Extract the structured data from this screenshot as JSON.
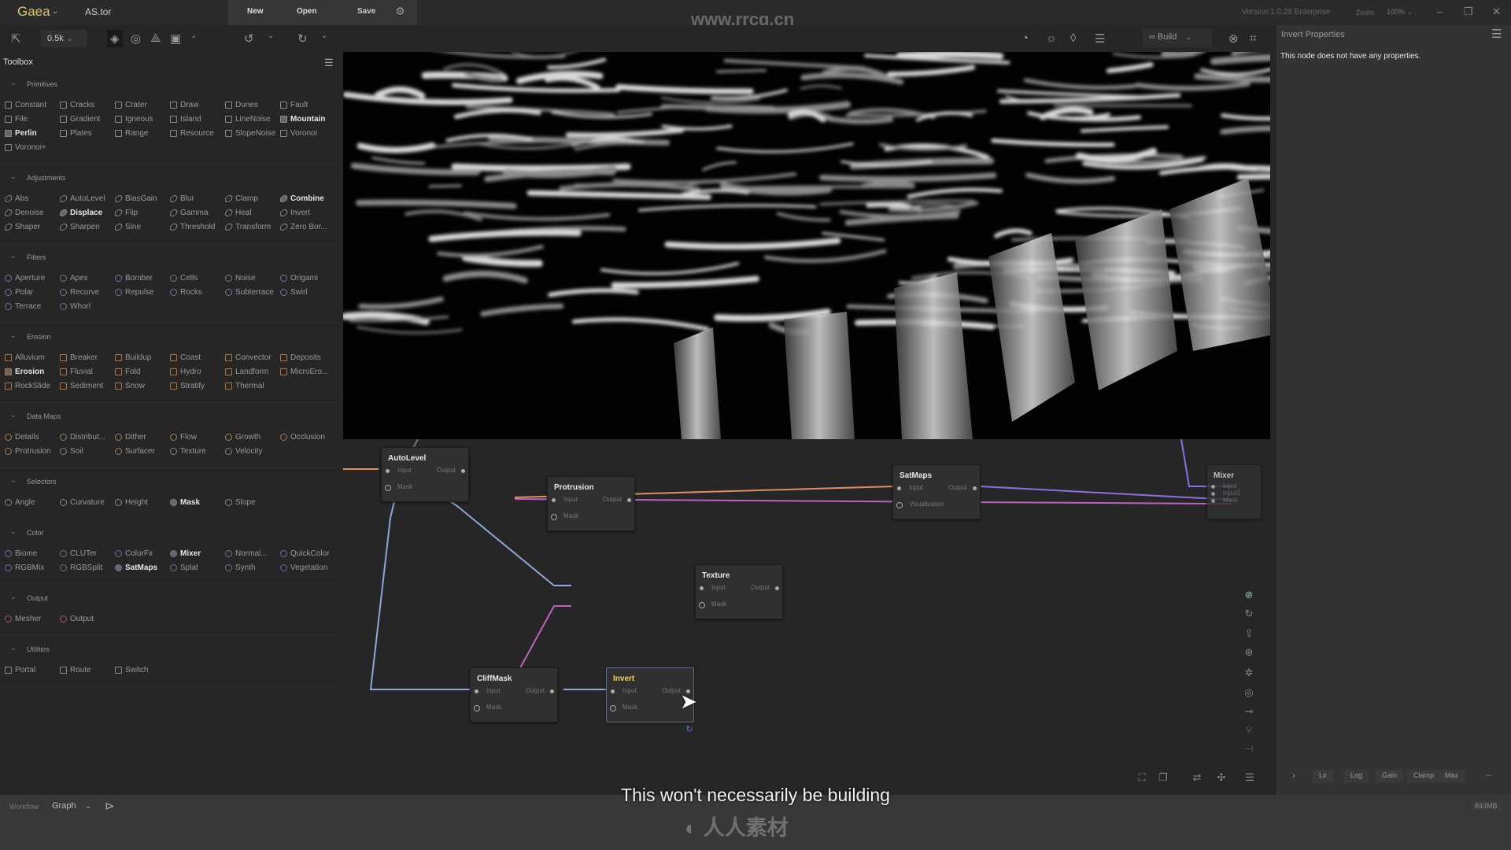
{
  "titlebar": {
    "app": "Gaea",
    "file": "AS.tor",
    "new": "New",
    "open": "Open",
    "save": "Save",
    "version": "Version 1.0.28 Enterprise",
    "zoom_label": "Zoom",
    "zoom_value": "100%",
    "watermark": "www.rrcg.cn"
  },
  "toolbar": {
    "resolution": "0.5k",
    "build": "Build"
  },
  "toolbox": {
    "title": "Toolbox",
    "sections": [
      {
        "title": "Primitives",
        "shape": "sq",
        "color": "#8a8a8a",
        "items": [
          "Constant",
          "Cracks",
          "Crater",
          "Draw",
          "Dunes",
          "Fault",
          "File",
          "Gradient",
          "Igneous",
          "Island",
          "LineNoise",
          "Mountain",
          "Perlin",
          "Plates",
          "Range",
          "Resource",
          "SlopeNoise",
          "Voronoi",
          "Voronoi+"
        ],
        "highlighted": [
          "Mountain",
          "Perlin"
        ]
      },
      {
        "title": "Adjustments",
        "shape": "sl",
        "color": "#8a8a8a",
        "items": [
          "Abs",
          "AutoLevel",
          "BiasGain",
          "Blur",
          "Clamp",
          "Combine",
          "Denoise",
          "Displace",
          "Flip",
          "Gamma",
          "Heal",
          "Invert",
          "Shaper",
          "Sharpen",
          "Sine",
          "Threshold",
          "Transform",
          "Zero Bor..."
        ],
        "highlighted": [
          "Combine",
          "Displace"
        ]
      },
      {
        "title": "Filters",
        "shape": "ci",
        "color": "#6a7a9a",
        "items": [
          "Aperture",
          "Apex",
          "Bomber",
          "Cells",
          "Noise",
          "Origami",
          "Polar",
          "Recurve",
          "Repulse",
          "Rocks",
          "Subterrace",
          "Swirl",
          "Terrace",
          "Whorl"
        ],
        "highlighted": []
      },
      {
        "title": "Erosion",
        "shape": "sq",
        "color": "#9a7a5a",
        "items": [
          "Alluvium",
          "Breaker",
          "Buildup",
          "Coast",
          "Convector",
          "Deposits",
          "Erosion",
          "Fluvial",
          "Fold",
          "Hydro",
          "Landform",
          "MicroEro...",
          "RockSlide",
          "Sediment",
          "Snow",
          "Stratify",
          "Thermal"
        ],
        "highlighted": [
          "Erosion"
        ]
      },
      {
        "title": "Data Maps",
        "shape": "ci",
        "color": "#9a8060",
        "items": [
          "Details",
          "Distribut...",
          "Dither",
          "Flow",
          "Growth",
          "Occlusion",
          "Protrusion",
          "Soil",
          "Surfacer",
          "Texture",
          "Velocity"
        ],
        "highlighted": []
      },
      {
        "title": "Selectors",
        "shape": "ci",
        "color": "#8a8a8a",
        "items": [
          "Angle",
          "Curvature",
          "Height",
          "Mask",
          "Slope"
        ],
        "highlighted": [
          "Mask"
        ]
      },
      {
        "title": "Color",
        "shape": "ci",
        "color": "#7a6a9a",
        "items": [
          "Biome",
          "CLUTer",
          "ColorFx",
          "Mixer",
          "Normal...",
          "QuickColor",
          "RGBMix",
          "RGBSplit",
          "SatMaps",
          "Splat",
          "Synth",
          "Vegetation"
        ],
        "highlighted": [
          "Mixer",
          "SatMaps"
        ]
      },
      {
        "title": "Output",
        "shape": "ci",
        "color": "#a05a5a",
        "items": [
          "Mesher",
          "Output"
        ],
        "highlighted": []
      },
      {
        "title": "Utilities",
        "shape": "sq",
        "color": "#8a8a8a",
        "items": [
          "Portal",
          "Route",
          "Switch"
        ],
        "highlighted": []
      }
    ]
  },
  "graph": {
    "nodes": [
      {
        "id": "autolevel",
        "title": "AutoLevel",
        "ports": [
          "Input",
          "Mask"
        ],
        "output": "Output"
      },
      {
        "id": "protrusion",
        "title": "Protrusion",
        "ports": [
          "Input",
          "Mask"
        ],
        "output": "Output"
      },
      {
        "id": "texture",
        "title": "Texture",
        "ports": [
          "Input",
          "Mask"
        ],
        "output": "Output"
      },
      {
        "id": "cliffmask",
        "title": "CliffMask",
        "ports": [
          "Input",
          "Mask"
        ],
        "output": "Output"
      },
      {
        "id": "invert",
        "title": "Invert",
        "ports": [
          "Input",
          "Mask"
        ],
        "output": "Output",
        "selected": true
      },
      {
        "id": "satmaps",
        "title": "SatMaps",
        "ports": [
          "Input",
          "Visualization"
        ],
        "output": "Output"
      },
      {
        "id": "mixer",
        "title": "Mixer",
        "ports": [
          "Input",
          "Input2",
          "Mask"
        ],
        "output": ""
      }
    ],
    "wire_colors": {
      "height": "#8fa6d8",
      "mask": "#c060c0",
      "color": "#e09060",
      "sat": "#8a70e0"
    }
  },
  "properties": {
    "title": "Invert Properties",
    "message": "This node does not have any properties."
  },
  "viewbar": {
    "items": [
      "Lv",
      "Log",
      "Gain",
      "Clamp",
      "Max"
    ],
    "more": "...",
    "memory": "843MB"
  },
  "workflow": {
    "label": "Workflow",
    "value": "Graph"
  },
  "subtitle": "This won't necessarily be building",
  "logo": "人人素材"
}
